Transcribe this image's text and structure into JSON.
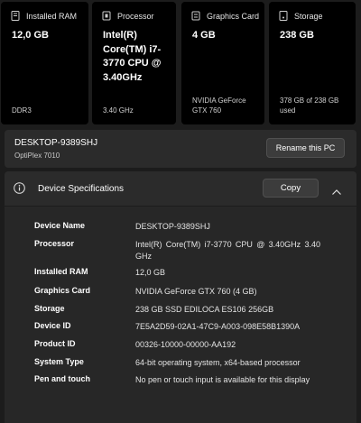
{
  "cards": [
    {
      "label": "Installed RAM",
      "icon": "memory-icon",
      "value": "12,0 GB",
      "detail": "DDR3"
    },
    {
      "label": "Processor",
      "icon": "processor-icon",
      "value": "Intel(R) Core(TM) i7-3770 CPU @ 3.40GHz",
      "detail": "3.40 GHz"
    },
    {
      "label": "Graphics Card",
      "icon": "graphics-card-icon",
      "value": "4 GB",
      "detail": "NVIDIA GeForce GTX 760"
    },
    {
      "label": "Storage",
      "icon": "storage-icon",
      "value": "238 GB",
      "detail": "378 GB of 238 GB used"
    }
  ],
  "pc": {
    "name": "DESKTOP-9389SHJ",
    "model": "OptiPlex 7010",
    "rename_label": "Rename this PC"
  },
  "specs": {
    "title": "Device Specifications",
    "copy_label": "Copy",
    "rows": [
      {
        "key": "Device Name",
        "value": "DESKTOP-9389SHJ"
      },
      {
        "key": "Processor",
        "value": "Intel(R) Core(TM) i7-3770 CPU @ 3.40GHz   3.40 GHz"
      },
      {
        "key": "Installed RAM",
        "value": "12,0 GB"
      },
      {
        "key": "Graphics Card",
        "value": "NVIDIA GeForce GTX 760 (4 GB)"
      },
      {
        "key": "Storage",
        "value": "238 GB SSD EDILOCA ES106 256GB"
      },
      {
        "key": "Device ID",
        "value": "7E5A2D59-02A1-47C9-A003-098E58B1390A"
      },
      {
        "key": "Product ID",
        "value": "00326-10000-00000-AA192"
      },
      {
        "key": "System Type",
        "value": "64-bit operating system, x64-based processor"
      },
      {
        "key": "Pen and touch",
        "value": "No pen or touch input is available for this display"
      }
    ]
  }
}
